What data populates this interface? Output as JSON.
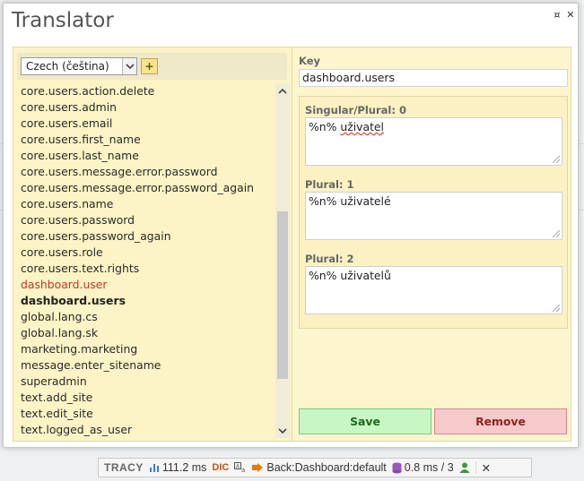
{
  "dialog": {
    "title": "Translator",
    "restore_symbol": "¤",
    "close_symbol": "✕"
  },
  "language": {
    "selected": "Czech (čeština)",
    "add_label": "+"
  },
  "keys": [
    "core.users.action.delete",
    "core.users.admin",
    "core.users.email",
    "core.users.first_name",
    "core.users.last_name",
    "core.users.message.error.password",
    "core.users.message.error.password_again",
    "core.users.name",
    "core.users.password",
    "core.users.password_again",
    "core.users.role",
    "core.users.text.rights",
    "dashboard.user",
    "dashboard.users",
    "global.lang.cs",
    "global.lang.sk",
    "marketing.marketing",
    "message.enter_sitename",
    "superadmin",
    "text.add_site",
    "text.edit_site",
    "text.logged_as_user"
  ],
  "key_states": {
    "error_index": 12,
    "selected_index": 13
  },
  "editor": {
    "key_label": "Key",
    "key_value": "dashboard.users",
    "plurals": [
      {
        "label": "Singular/Plural: 0",
        "prefix": "%n% ",
        "word": "uživatel"
      },
      {
        "label": "Plural: 1",
        "prefix": "%n% ",
        "word": "uživatelé"
      },
      {
        "label": "Plural: 2",
        "prefix": "%n% ",
        "word": "uživatelů"
      }
    ],
    "save_label": "Save",
    "remove_label": "Remove"
  },
  "tracy": {
    "logo": "TRACY",
    "time": "111.2 ms",
    "dic": "DIC",
    "route": "Back:Dashboard:default",
    "db": "0.8 ms / 3",
    "close": "✕"
  },
  "colors": {
    "panel_bg": "#fdf5cd",
    "save_bg": "#c9f7c4",
    "remove_bg": "#f6caca",
    "error_key": "#c0392b"
  }
}
